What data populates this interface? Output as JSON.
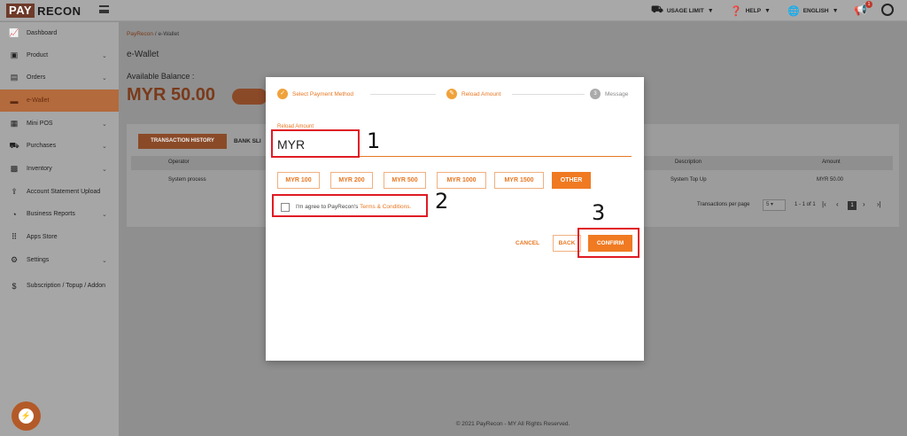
{
  "brand": {
    "logo_pay": "PAY",
    "logo_recon": "RECON"
  },
  "header": {
    "usage_limit": "USAGE LIMIT",
    "help": "HELP",
    "language": "ENGLISH",
    "notification_count": "1"
  },
  "sidebar": {
    "items": [
      {
        "label": "Dashboard",
        "icon": "chart-line-icon",
        "glyph": "📈"
      },
      {
        "label": "Product",
        "icon": "box-icon",
        "glyph": "▣"
      },
      {
        "label": "Orders",
        "icon": "clipboard-icon",
        "glyph": "▤"
      },
      {
        "label": "e-Wallet",
        "icon": "wallet-icon",
        "glyph": "▬",
        "active": true
      },
      {
        "label": "Mini POS",
        "icon": "pos-icon",
        "glyph": "▦"
      },
      {
        "label": "Purchases",
        "icon": "truck-icon",
        "glyph": "⛟"
      },
      {
        "label": "Inventory",
        "icon": "boxes-icon",
        "glyph": "▩"
      },
      {
        "label": "Account Statement Upload",
        "icon": "upload-icon",
        "glyph": "⇪"
      },
      {
        "label": "Business Reports",
        "icon": "pie-chart-icon",
        "glyph": "◔"
      },
      {
        "label": "Apps Store",
        "icon": "grid-icon",
        "glyph": "⠿"
      },
      {
        "label": "Settings",
        "icon": "gear-icon",
        "glyph": "⚙"
      },
      {
        "label": "Subscription / Topup / Addon",
        "icon": "dollar-icon",
        "glyph": "$"
      }
    ]
  },
  "breadcrumb": {
    "root": "PayRecon",
    "sep": "/",
    "current": "e-Wallet"
  },
  "page": {
    "title": "e-Wallet",
    "balance_label": "Available Balance :",
    "balance_value": "MYR 50.00"
  },
  "tabs": {
    "history": "TRANSACTION HISTORY",
    "bank": "BANK SLI"
  },
  "table": {
    "headers": {
      "operator": "Operator",
      "description": "Description",
      "amount": "Amount"
    },
    "row": {
      "operator": "System process",
      "description": "System Top Up",
      "amount": "MYR 50.00"
    }
  },
  "pager": {
    "per_page_label": "Transactions per page",
    "per_page_value": "5",
    "range": "1 - 1 of 1",
    "current_page": "1"
  },
  "footer": {
    "text": "© 2021 PayRecon - MY All Rights Reserved."
  },
  "modal": {
    "steps": [
      {
        "label": "Select Payment Method",
        "num": "✓"
      },
      {
        "label": "Reload Amount",
        "num": "✎"
      },
      {
        "label": "Message",
        "num": "3"
      }
    ],
    "amount_label": "Reload Amount",
    "amount_value": "MYR",
    "chips": [
      "MYR 100",
      "MYR 200",
      "MYR 500",
      "MYR 1000",
      "MYR 1500",
      "OTHER"
    ],
    "agree_prefix": "I'm agree to PayRecon's ",
    "agree_link": "Terms & Conditions.",
    "cancel": "CANCEL",
    "back": "BACK",
    "confirm": "CONFIRM"
  },
  "annotations": {
    "n1": "1",
    "n2": "2",
    "n3": "3"
  },
  "colors": {
    "accent": "#f07a22",
    "annotation": "#e01b24"
  }
}
